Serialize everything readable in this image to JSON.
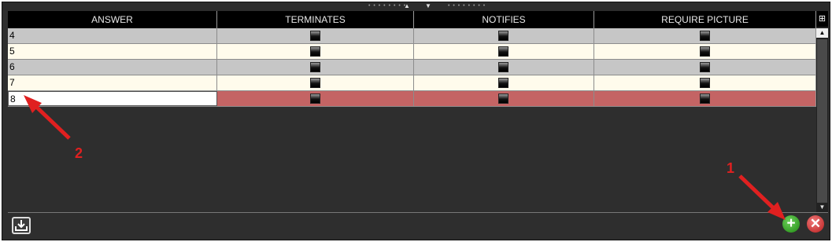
{
  "columns": [
    "ANSWER",
    "TERMINATES",
    "NOTIFIES",
    "REQUIRE PICTURE"
  ],
  "rows": [
    {
      "answer": "4",
      "terminates": false,
      "notifies": false,
      "require_picture": false
    },
    {
      "answer": "5",
      "terminates": false,
      "notifies": false,
      "require_picture": false
    },
    {
      "answer": "6",
      "terminates": false,
      "notifies": false,
      "require_picture": false
    },
    {
      "answer": "7",
      "terminates": false,
      "notifies": false,
      "require_picture": false
    },
    {
      "answer": "8",
      "terminates": false,
      "notifies": false,
      "require_picture": false,
      "selected": true
    }
  ],
  "annotations": {
    "arrow_1_label": "1",
    "arrow_2_label": "2"
  },
  "buttons": {
    "add_icon": "plus-icon",
    "add_symbol": "+",
    "cancel_icon": "x-icon",
    "cancel_symbol": "✕",
    "export_icon": "tray-download-icon"
  },
  "colors": {
    "selected_row": "#c46464",
    "odd_row": "#c6c6c6",
    "even_row": "#fffbec",
    "annotation": "#e02020",
    "add": "#2e9a1e",
    "cancel": "#d03030"
  }
}
